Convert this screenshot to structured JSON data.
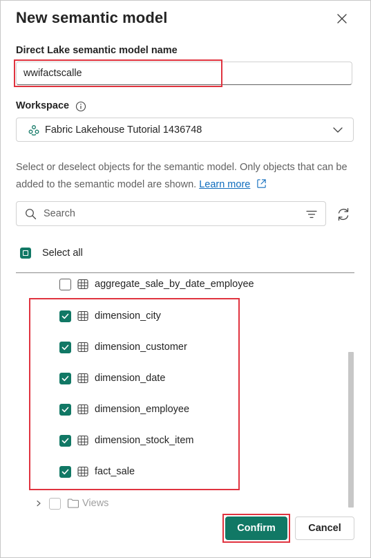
{
  "dialog": {
    "title": "New semantic model",
    "close_icon": "close-icon"
  },
  "model_name": {
    "label": "Direct Lake semantic model name",
    "value": "wwifactscalle"
  },
  "workspace": {
    "label": "Workspace",
    "info_icon": "info-icon",
    "selected": "Fabric Lakehouse Tutorial 1436748",
    "icon": "workspace-icon"
  },
  "description": {
    "text": "Select or deselect objects for the semantic model. Only objects that can be added to the semantic model are shown.",
    "link": "Learn more"
  },
  "search": {
    "placeholder": "Search"
  },
  "select_all": {
    "label": "Select all",
    "state": "indeterminate"
  },
  "tables": [
    {
      "label": "aggregate_sale_by_date_employee",
      "checked": false
    },
    {
      "label": "dimension_city",
      "checked": true
    },
    {
      "label": "dimension_customer",
      "checked": true
    },
    {
      "label": "dimension_date",
      "checked": true
    },
    {
      "label": "dimension_employee",
      "checked": true
    },
    {
      "label": "dimension_stock_item",
      "checked": true
    },
    {
      "label": "fact_sale",
      "checked": true
    }
  ],
  "views": {
    "label": "Views",
    "expanded": false
  },
  "buttons": {
    "confirm": "Confirm",
    "cancel": "Cancel"
  },
  "colors": {
    "accent": "#117865",
    "highlight": "#e0333f",
    "link": "#0f6cbd"
  }
}
